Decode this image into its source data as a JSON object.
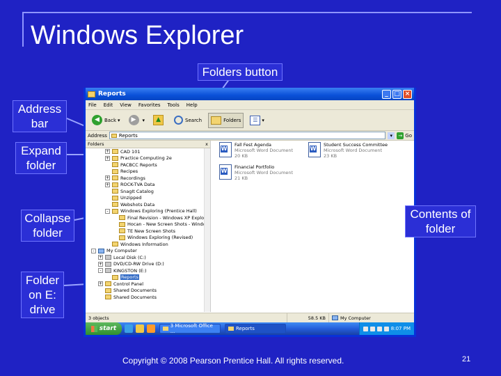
{
  "slide": {
    "title": "Windows Explorer",
    "copyright": "Copyright © 2008 Pearson Prentice Hall. All rights reserved.",
    "page_number": "21",
    "background_color": "#1f22c4"
  },
  "callouts": {
    "folders_button": "Folders button",
    "address_bar": "Address bar",
    "expand_folder": "Expand folder",
    "collapse_folder": "Collapse folder",
    "contents_of_folder": "Contents of folder",
    "folder_on_e": "Folder on E: drive"
  },
  "window": {
    "title": "Reports",
    "menu": [
      "File",
      "Edit",
      "View",
      "Favorites",
      "Tools",
      "Help"
    ],
    "toolbar": {
      "back": "Back",
      "search": "Search",
      "folders": "Folders"
    },
    "address": {
      "label": "Address",
      "value": "Reports",
      "go": "Go"
    },
    "folders_pane": {
      "header": "Folders",
      "close": "x",
      "tree": [
        {
          "label": "CAD 101",
          "toggle": "+",
          "indent": 2,
          "icon": "folder"
        },
        {
          "label": "Practice Computing 2e",
          "toggle": "+",
          "indent": 2,
          "icon": "folder"
        },
        {
          "label": "PACBCC Reports",
          "toggle": "",
          "indent": 2,
          "icon": "folder"
        },
        {
          "label": "Recipes",
          "toggle": "",
          "indent": 2,
          "icon": "folder"
        },
        {
          "label": "Recordings",
          "toggle": "+",
          "indent": 2,
          "icon": "folder"
        },
        {
          "label": "ROCK-TVA Data",
          "toggle": "+",
          "indent": 2,
          "icon": "folder"
        },
        {
          "label": "SnagIt Catalog",
          "toggle": "",
          "indent": 2,
          "icon": "folder"
        },
        {
          "label": "Unzipped",
          "toggle": "",
          "indent": 2,
          "icon": "folder"
        },
        {
          "label": "Webshots Data",
          "toggle": "",
          "indent": 2,
          "icon": "folder"
        },
        {
          "label": "Windows Exploring (Prentice Hall)",
          "toggle": "-",
          "indent": 2,
          "icon": "folder"
        },
        {
          "label": "Final Revision - Windows XP Exploring",
          "toggle": "",
          "indent": 3,
          "icon": "folder"
        },
        {
          "label": "Hocan - New Screen Shots - Windows XP (",
          "toggle": "",
          "indent": 3,
          "icon": "folder"
        },
        {
          "label": "TE New Screen Shots",
          "toggle": "",
          "indent": 3,
          "icon": "folder"
        },
        {
          "label": "Windows Exploring (Revised)",
          "toggle": "",
          "indent": 3,
          "icon": "folder"
        },
        {
          "label": "Windows Information",
          "toggle": "",
          "indent": 2,
          "icon": "folder"
        },
        {
          "label": "My Computer",
          "toggle": "-",
          "indent": 0,
          "icon": "pc"
        },
        {
          "label": "Local Disk (C:)",
          "toggle": "+",
          "indent": 1,
          "icon": "drive"
        },
        {
          "label": "DVD/CD-RW Drive (D:)",
          "toggle": "+",
          "indent": 1,
          "icon": "drive"
        },
        {
          "label": "KINGSTON (E:)",
          "toggle": "-",
          "indent": 1,
          "icon": "drive"
        },
        {
          "label": "Reports",
          "toggle": "",
          "indent": 2,
          "icon": "folder",
          "selected": true
        },
        {
          "label": "Control Panel",
          "toggle": "+",
          "indent": 1,
          "icon": "folder"
        },
        {
          "label": "Shared Documents",
          "toggle": "",
          "indent": 1,
          "icon": "folder"
        },
        {
          "label": "Shared Documents",
          "toggle": "",
          "indent": 1,
          "icon": "folder"
        }
      ]
    },
    "files": [
      {
        "name": "Fall Fest Agenda",
        "type": "Microsoft Word Document",
        "size": "20 KB"
      },
      {
        "name": "Student Success Committee",
        "type": "Microsoft Word Document",
        "size": "23 KB"
      },
      {
        "name": "Financial Portfolio",
        "type": "Microsoft Word Document",
        "size": "21 KB"
      }
    ],
    "status": {
      "objects": "3 objects",
      "size": "58.5 KB",
      "location": "My Computer"
    },
    "taskbar": {
      "start": "start",
      "tasks": [
        "3 Microsoft Office ...",
        "Reports"
      ],
      "clock": "8:07 PM"
    }
  }
}
